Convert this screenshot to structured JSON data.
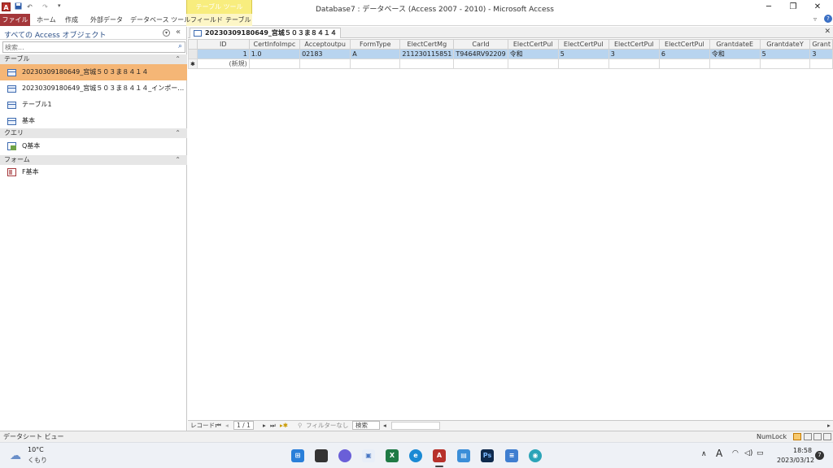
{
  "titlebar": {
    "window_title": "Database7 : データベース (Access 2007 - 2010) - Microsoft Access",
    "contextual_group": "テーブル ツール",
    "app_icon_letter": "A",
    "undo": "↶",
    "redo": "↷",
    "minimize": "─",
    "maximize": "❐",
    "close": "✕"
  },
  "ribbon": {
    "tabs": [
      "ファイル",
      "ホーム",
      "作成",
      "外部データ",
      "データベース ツール",
      "フィールド",
      "テーブル"
    ],
    "help": "?"
  },
  "nav": {
    "title": "すべての Access オブジェクト",
    "search_placeholder": "検索...",
    "groups": {
      "tables": "テーブル",
      "queries": "クエリ",
      "forms": "フォーム"
    },
    "tables": [
      "20230309180649_宮城５０３ま８４１４",
      "20230309180649_宮城５０３ま８４１４_インポート エラー",
      "テーブル1",
      "基本"
    ],
    "queries": [
      "Q基本"
    ],
    "forms": [
      "F基本"
    ]
  },
  "document": {
    "tab_title": "20230309180649_宮城５０３ま８４１４",
    "close": "✕",
    "columns": [
      "ID",
      "CertInfoImpc",
      "Acceptoutpu",
      "FormType",
      "ElectCertMg",
      "CarId",
      "ElectCertPul",
      "ElectCertPul",
      "ElectCertPul",
      "ElectCertPul",
      "GrantdateE",
      "GrantdateY",
      "Grant"
    ],
    "rows": [
      [
        "1",
        "1.0",
        "02183",
        "A",
        "211230115851",
        "T9464RV92209",
        "令和",
        "5",
        "3",
        "6",
        "令和",
        "5",
        "3"
      ]
    ],
    "new_row_label": "(新規)"
  },
  "record_nav": {
    "label": "レコード:",
    "position": "1 / 1",
    "filter": "フィルターなし",
    "search": "検索"
  },
  "statusbar": {
    "view": "データシート ビュー",
    "numlock": "NumLock"
  },
  "taskbar": {
    "temperature": "10°C",
    "weather": "くもり",
    "time": "18:58",
    "date": "2023/03/12",
    "ime": "A",
    "notifications": "7"
  }
}
